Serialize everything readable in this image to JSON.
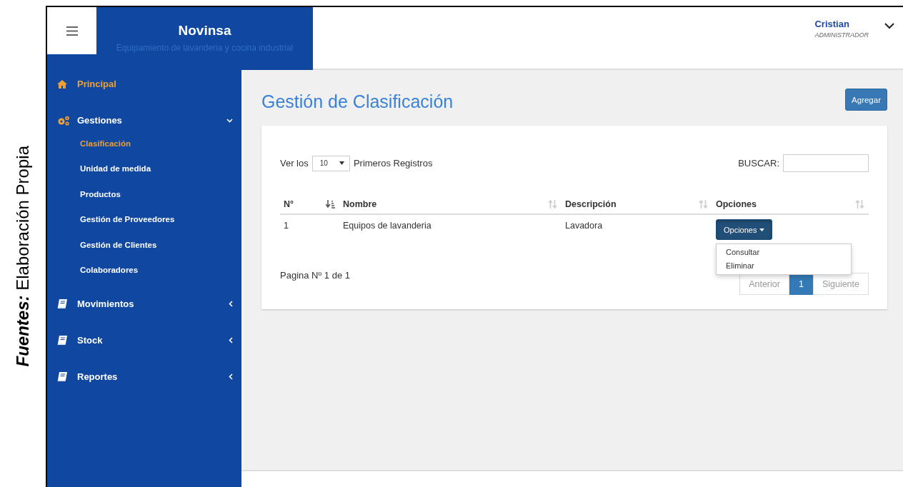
{
  "caption": {
    "text": "**Fuentes:** Elaboración Propia"
  },
  "header": {
    "brand": "Novinsa",
    "tagline": "Equipamiento de lavanderia y cocina industrial",
    "user": {
      "name": "Cristian",
      "role": "ADMINISTRADOR"
    }
  },
  "sidebar": {
    "items": [
      {
        "label": "Principal",
        "kind": "home",
        "selected": true
      },
      {
        "label": "Gestiones",
        "kind": "gears",
        "selected": false,
        "expanded": true,
        "children": [
          {
            "label": "Clasificación",
            "selected": true
          },
          {
            "label": "Unidad de medida",
            "selected": false
          },
          {
            "label": "Productos",
            "selected": false
          },
          {
            "label": "Gestión de Proveedores",
            "selected": false
          },
          {
            "label": "Gestión de Clientes",
            "selected": false
          },
          {
            "label": "Colaboradores",
            "selected": false
          }
        ]
      },
      {
        "label": "Movimientos",
        "kind": "book",
        "selected": false,
        "expanded": false
      },
      {
        "label": "Stock",
        "kind": "book",
        "selected": false,
        "expanded": false
      },
      {
        "label": "Reportes",
        "kind": "book",
        "selected": false,
        "expanded": false
      }
    ]
  },
  "main": {
    "title": "Gestión de Clasificación",
    "add_button": "Agregar",
    "table": {
      "length_before": "Ver los",
      "page_size": "10",
      "length_after": "Primeros Registros",
      "search_label": "BUSCAR:",
      "columns": [
        {
          "label": "N°",
          "sorted": true
        },
        {
          "label": "Nombre",
          "sorted": false
        },
        {
          "label": "Descripción",
          "sorted": false
        },
        {
          "label": "Opciones",
          "sorted": false
        }
      ],
      "rows": [
        {
          "cells": [
            "1",
            "Equipos de lavanderia",
            "Lavadora"
          ],
          "action": "Opciones",
          "expanded": true,
          "menu": [
            "Consultar",
            "Eliminar"
          ]
        }
      ],
      "info": "Pagina Nº 1 de 1",
      "pagination": [
        {
          "label": "Anterior",
          "disabled": true,
          "selected": false
        },
        {
          "label": "1",
          "disabled": false,
          "selected": true
        },
        {
          "label": "Siguiente",
          "disabled": true,
          "selected": false
        }
      ]
    }
  }
}
